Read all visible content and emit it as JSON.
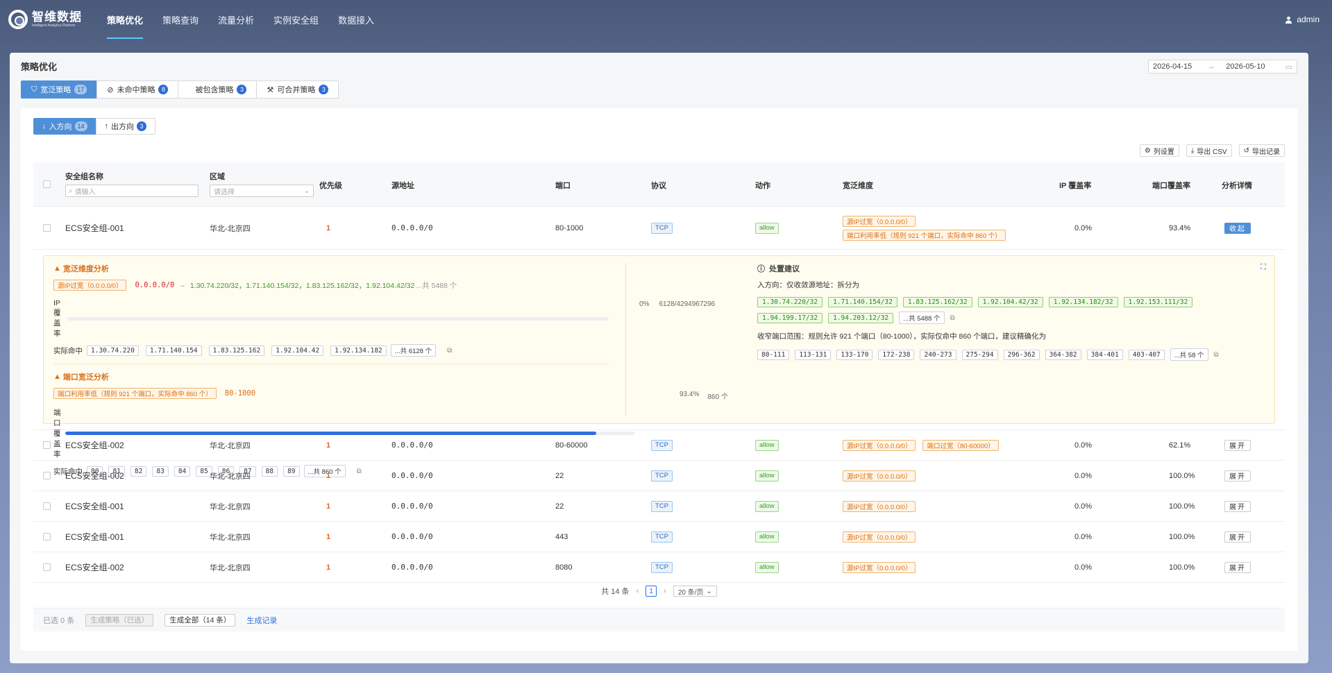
{
  "brand": {
    "title": "智维数据",
    "subtitle": "Intelligent Analytics Platform"
  },
  "nav": [
    {
      "label": "策略优化",
      "active": true
    },
    {
      "label": "策略查询"
    },
    {
      "label": "流量分析"
    },
    {
      "label": "实例安全组"
    },
    {
      "label": "数据接入"
    }
  ],
  "user": {
    "name": "admin"
  },
  "page": {
    "title": "策略优化"
  },
  "daterange": {
    "start": "2026-04-15",
    "end": "2026-05-10"
  },
  "tabs": [
    {
      "label": "宽泛策略",
      "count": "17"
    },
    {
      "label": "未命中策略",
      "count": "8"
    },
    {
      "label": "被包含策略",
      "count": "3"
    },
    {
      "label": "可合并策略",
      "count": "3"
    }
  ],
  "dirtabs": [
    {
      "label": "入方向",
      "count": "14"
    },
    {
      "label": "出方向",
      "count": "3"
    }
  ],
  "tools": {
    "columns": "列设置",
    "export_csv": "导出 CSV",
    "export_log": "导出记录"
  },
  "columns": {
    "name": "安全组名称",
    "name_placeholder": "请输入",
    "region": "区域",
    "region_placeholder": "请选择",
    "priority": "优先级",
    "source": "源地址",
    "port": "端口",
    "protocol": "协议",
    "action": "动作",
    "breadth": "宽泛维度",
    "ip_cov": "IP 覆盖率",
    "port_cov": "端口覆盖率",
    "detail": "分析详情"
  },
  "rows": [
    {
      "name": "ECS安全组-001",
      "region": "华北-北京四",
      "priority": "1",
      "source": "0.0.0.0/0",
      "port": "80-1000",
      "protocol": "TCP",
      "action": "allow",
      "tags": [
        "源IP过宽（0.0.0.0/0）",
        "端口利用率低（规则 921 个端口，实际命中 860 个）"
      ],
      "ip_cov": "0.0%",
      "port_cov": "93.4%",
      "toggle": "收起"
    },
    {
      "name": "ECS安全组-002",
      "region": "华北-北京四",
      "priority": "1",
      "source": "0.0.0.0/0",
      "port": "80-60000",
      "protocol": "TCP",
      "action": "allow",
      "tags": [
        "源IP过宽（0.0.0.0/0）",
        "端口过宽（80-60000）"
      ],
      "ip_cov": "0.0%",
      "port_cov": "62.1%",
      "toggle": "展开"
    },
    {
      "name": "ECS安全组-002",
      "region": "华北-北京四",
      "priority": "1",
      "source": "0.0.0.0/0",
      "port": "22",
      "protocol": "TCP",
      "action": "allow",
      "tags": [
        "源IP过宽（0.0.0.0/0）"
      ],
      "ip_cov": "0.0%",
      "port_cov": "100.0%",
      "toggle": "展开"
    },
    {
      "name": "ECS安全组-001",
      "region": "华北-北京四",
      "priority": "1",
      "source": "0.0.0.0/0",
      "port": "22",
      "protocol": "TCP",
      "action": "allow",
      "tags": [
        "源IP过宽（0.0.0.0/0）"
      ],
      "ip_cov": "0.0%",
      "port_cov": "100.0%",
      "toggle": "展开"
    },
    {
      "name": "ECS安全组-001",
      "region": "华北-北京四",
      "priority": "1",
      "source": "0.0.0.0/0",
      "port": "443",
      "protocol": "TCP",
      "action": "allow",
      "tags": [
        "源IP过宽（0.0.0.0/0）"
      ],
      "ip_cov": "0.0%",
      "port_cov": "100.0%",
      "toggle": "展开"
    },
    {
      "name": "ECS安全组-002",
      "region": "华北-北京四",
      "priority": "1",
      "source": "0.0.0.0/0",
      "port": "8080",
      "protocol": "TCP",
      "action": "allow",
      "tags": [
        "源IP过宽（0.0.0.0/0）"
      ],
      "ip_cov": "0.0%",
      "port_cov": "100.0%",
      "toggle": "展开"
    }
  ],
  "analysis": {
    "title": "宽泛维度分析",
    "src_tag": "源IP过宽（0.0.0.0/0）",
    "src_from": "0.0.0.0/0",
    "src_to": "1.30.74.220/32，1.71.140.154/32，1.83.125.162/32，1.92.104.42/32",
    "src_more": "...共 5488 个",
    "ip_cov_label": "IP 覆盖率",
    "ip_cov_pct": "0%",
    "ip_cov_value": 0,
    "ip_cov_count": "6128/4294967296",
    "hit_label": "实际命中",
    "ip_hits": [
      "1.30.74.220",
      "1.71.140.154",
      "1.83.125.162",
      "1.92.104.42",
      "1.92.134.182"
    ],
    "ip_hits_more": "...共 6128 个",
    "port_title": "端口宽泛分析",
    "port_tag": "端口利用率低（规则 921 个端口，实际命中 860 个）",
    "port_range": "80-1000",
    "port_cov_label": "端口覆盖率",
    "port_cov_pct": "93.4%",
    "port_cov_value": 0.934,
    "port_cov_count": "860 个",
    "port_hits": [
      "80",
      "81",
      "82",
      "83",
      "84",
      "85",
      "86",
      "87",
      "88",
      "89"
    ],
    "port_hits_more": "...共 860 个"
  },
  "suggest": {
    "title": "处置建议",
    "line1": "入方向：仅收敛源地址：拆分为",
    "ips": [
      "1.30.74.220/32",
      "1.71.140.154/32",
      "1.83.125.162/32",
      "1.92.104.42/32",
      "1.92.134.182/32",
      "1.92.153.111/32",
      "1.94.199.17/32",
      "1.94.203.12/32"
    ],
    "ips_more": "...共 5488 个",
    "line2": "收窄端口范围：规则允许 921 个端口（80-1000），实际仅命中 860 个端口，建议精确化为",
    "ports": [
      "80-111",
      "113-131",
      "133-170",
      "172-238",
      "240-273",
      "275-294",
      "296-362",
      "364-382",
      "384-401",
      "403-407"
    ],
    "ports_more": "...共 58 个"
  },
  "pager": {
    "total": "共 14 条",
    "page": "1",
    "size": "20 条/页"
  },
  "footer": {
    "selected": "已选 0 条",
    "gen": "生成策略（已选）",
    "gen_all": "生成全部（14 条）",
    "log": "生成记录"
  },
  "colors": {
    "primary": "#4f8fd8",
    "accent": "#2f6fe0",
    "warn": "#d86e12",
    "ok": "#3c9a2b"
  }
}
